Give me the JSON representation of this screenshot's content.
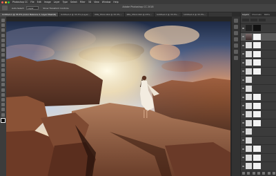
{
  "menubar": {
    "items": [
      "Photoshop CC",
      "File",
      "Edit",
      "Image",
      "Layer",
      "Type",
      "Select",
      "Filter",
      "3D",
      "View",
      "Window",
      "Help"
    ]
  },
  "window": {
    "title": "Adobe Photoshop CC 2018"
  },
  "options": {
    "auto_select_label": "Auto-Select:",
    "auto_select_value": "Layer",
    "transform_label": "Show Transform Controls"
  },
  "tabs": [
    {
      "label": "Untitled-1 @ 33.3% (Color Balance 2, Layer Mask/8)",
      "active": true
    },
    {
      "label": "Untitled-2 @ 33.3% (Layer...",
      "active": false
    },
    {
      "label": "IMG_5511.CR2 @ 33.3%...",
      "active": false
    },
    {
      "label": "IMG_5512.CR2 @ 25%...",
      "active": false
    },
    {
      "label": "Untitled-3 @ 33.3%...",
      "active": false
    },
    {
      "label": "Untitled-4 @ 33.3%...",
      "active": false
    }
  ],
  "layers_panel": {
    "tabs": [
      "Layers",
      "Channels",
      "Paths"
    ],
    "layers": [
      {
        "name": "",
        "thumb": "dark",
        "mask": "black",
        "selected": false
      },
      {
        "name": "",
        "thumb": "photo",
        "mask": "white",
        "selected": true
      },
      {
        "name": "",
        "thumb": "white",
        "mask": "white",
        "selected": false
      },
      {
        "name": "",
        "thumb": "white",
        "mask": "white",
        "selected": false
      },
      {
        "name": "",
        "thumb": "white",
        "mask": "white",
        "selected": false
      },
      {
        "name": "",
        "thumb": "white",
        "mask": "white",
        "selected": false
      },
      {
        "name": "",
        "thumb": "white",
        "mask": "none",
        "selected": false
      },
      {
        "name": "",
        "thumb": "white",
        "mask": "none",
        "selected": false
      },
      {
        "name": "",
        "thumb": "white",
        "mask": "white",
        "selected": false
      },
      {
        "name": "",
        "thumb": "white",
        "mask": "white",
        "selected": false
      },
      {
        "name": "",
        "thumb": "white",
        "mask": "white",
        "selected": false
      },
      {
        "name": "",
        "thumb": "white",
        "mask": "white",
        "selected": false
      },
      {
        "name": "",
        "thumb": "white",
        "mask": "none",
        "selected": false
      },
      {
        "name": "",
        "thumb": "white",
        "mask": "none",
        "selected": false
      },
      {
        "name": "",
        "thumb": "white",
        "mask": "white",
        "selected": false
      },
      {
        "name": "",
        "thumb": "white",
        "mask": "white",
        "selected": false
      },
      {
        "name": "",
        "thumb": "white",
        "mask": "white",
        "selected": false
      }
    ]
  },
  "colors": {
    "traffic_red": "#ff5f57",
    "traffic_yellow": "#febc2e",
    "traffic_green": "#28c840"
  }
}
